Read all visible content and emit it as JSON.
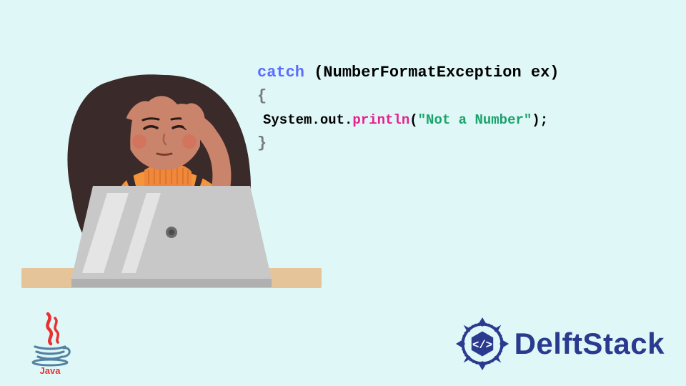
{
  "code": {
    "keyword_catch": "catch",
    "paren_open": " (",
    "exception_type": "NumberFormatException",
    "exception_var": " ex",
    "paren_close": ")",
    "brace_open": "{",
    "sys_out": "System.out.",
    "method": "println",
    "paren_open2": "(",
    "string_literal": "\"Not a Number\"",
    "paren_close2": ")",
    "semi": ";",
    "brace_close": "}"
  },
  "logos": {
    "java_label": "Java",
    "delft_label": "DelftStack"
  }
}
